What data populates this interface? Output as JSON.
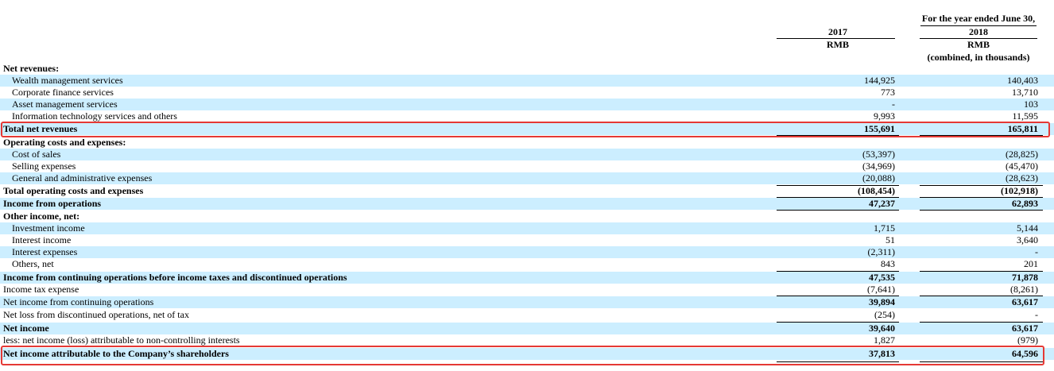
{
  "header": {
    "period": "For the year ended June 30,",
    "col_2017": "2017",
    "col_2018": "2018",
    "currency_2017": "RMB",
    "currency_2018": "RMB",
    "unit_note": "(combined, in thousands)"
  },
  "rows": [
    {
      "label": "Net revenues:",
      "v2017": "",
      "v2018": ""
    },
    {
      "label": "Wealth management services",
      "v2017": "144,925",
      "v2018": "140,403"
    },
    {
      "label": "Corporate finance services",
      "v2017": "773",
      "v2018": "13,710"
    },
    {
      "label": "Asset management services",
      "v2017": "-",
      "v2018": "103"
    },
    {
      "label": "Information technology services and others",
      "v2017": "9,993",
      "v2018": "11,595"
    },
    {
      "label": "Total net revenues",
      "v2017": "155,691",
      "v2018": "165,811"
    },
    {
      "label": "Operating costs and expenses:",
      "v2017": "",
      "v2018": ""
    },
    {
      "label": "Cost of sales",
      "v2017": "(53,397)",
      "v2018": "(28,825)"
    },
    {
      "label": "Selling expenses",
      "v2017": "(34,969)",
      "v2018": "(45,470)"
    },
    {
      "label": "General and administrative expenses",
      "v2017": "(20,088)",
      "v2018": "(28,623)"
    },
    {
      "label": "Total operating costs and expenses",
      "v2017": "(108,454)",
      "v2018": "(102,918)"
    },
    {
      "label": "Income from operations",
      "v2017": "47,237",
      "v2018": "62,893"
    },
    {
      "label": "Other income, net:",
      "v2017": "",
      "v2018": ""
    },
    {
      "label": "Investment income",
      "v2017": "1,715",
      "v2018": "5,144"
    },
    {
      "label": "Interest income",
      "v2017": "51",
      "v2018": "3,640"
    },
    {
      "label": "Interest expenses",
      "v2017": "(2,311)",
      "v2018": "-"
    },
    {
      "label": "Others, net",
      "v2017": "843",
      "v2018": "201"
    },
    {
      "label": "Income from continuing operations before income taxes and discontinued operations",
      "v2017": "47,535",
      "v2018": "71,878"
    },
    {
      "label": "Income tax expense",
      "v2017": "(7,641)",
      "v2018": "(8,261)"
    },
    {
      "label": "Net income from continuing operations",
      "v2017": "39,894",
      "v2018": "63,617"
    },
    {
      "label": "Net loss from discontinued operations, net of tax",
      "v2017": "(254)",
      "v2018": "-"
    },
    {
      "label": "Net income",
      "v2017": "39,640",
      "v2018": "63,617"
    },
    {
      "label": "less: net income (loss) attributable to non-controlling interests",
      "v2017": "1,827",
      "v2018": "(979)"
    },
    {
      "label": "Net income attributable to the Company’s shareholders",
      "v2017": "37,813",
      "v2018": "64,596"
    }
  ],
  "colors": {
    "shade": "#cceeff",
    "highlight": "#e53935"
  }
}
